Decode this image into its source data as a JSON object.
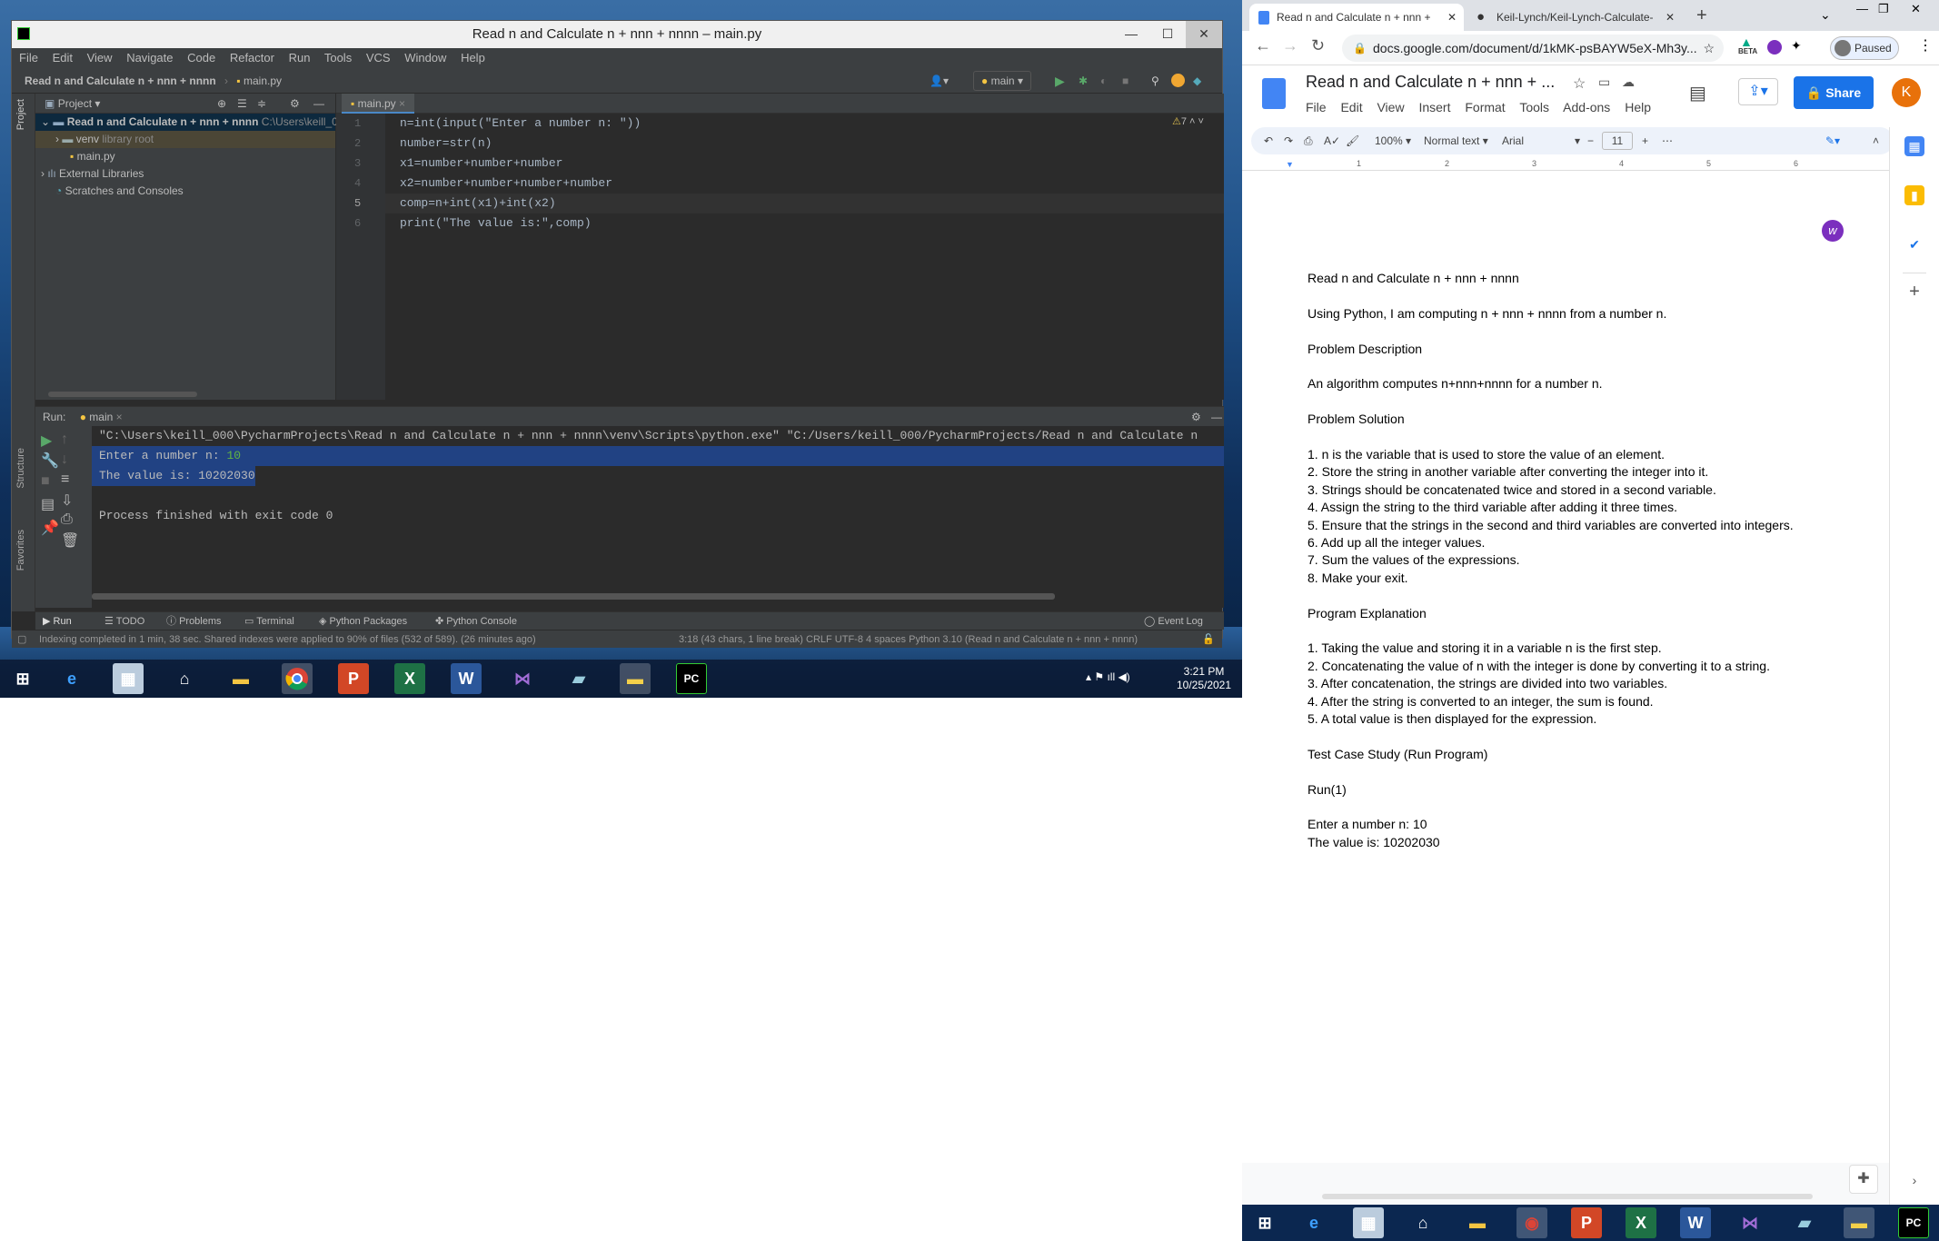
{
  "pycharm": {
    "window_title": "Read n and Calculate n + nnn + nnnn – main.py",
    "menu": [
      "File",
      "Edit",
      "View",
      "Navigate",
      "Code",
      "Refactor",
      "Run",
      "Tools",
      "VCS",
      "Window",
      "Help"
    ],
    "breadcrumb_project": "Read n and Calculate n + nnn + nnnn",
    "breadcrumb_file": "main.py",
    "run_config": "main",
    "project_panel_title": "Project",
    "tree": {
      "root": "Read n and Calculate n + nnn + nnnn",
      "root_path": "C:\\Users\\keill_0",
      "venv": "venv",
      "venv_note": "library root",
      "main": "main.py",
      "external": "External Libraries",
      "scratches": "Scratches and Consoles"
    },
    "editor_tab": "main.py",
    "warning_count": "7",
    "code": [
      "n=int(input(\"Enter a number n: \"))",
      "number=str(n)",
      "x1=number+number+number",
      "x2=number+number+number+number",
      "comp=n+int(x1)+int(x2)",
      "print(\"The value is:\",comp)"
    ],
    "line_numbers": [
      "1",
      "2",
      "3",
      "4",
      "5",
      "6"
    ],
    "run_label": "Run:",
    "run_tab": "main",
    "console": [
      "\"C:\\Users\\keill_000\\PycharmProjects\\Read n and Calculate n + nnn + nnnn\\venv\\Scripts\\python.exe\" \"C:/Users/keill_000/PycharmProjects/Read n and Calculate n",
      "Enter a number n: ",
      "The value is: 10202030",
      "",
      "Process finished with exit code 0"
    ],
    "console_input": "10",
    "bottom_tabs": [
      "Run",
      "TODO",
      "Problems",
      "Terminal",
      "Python Packages",
      "Python Console"
    ],
    "event_log": "Event Log",
    "status_left": "Indexing completed in 1 min, 38 sec. Shared indexes were applied to 90% of files (532 of 589). (26 minutes ago)",
    "status_right": "3:18 (43 chars, 1 line break)   CRLF   UTF-8   4 spaces   Python 3.10 (Read n and Calculate n + nnn + nnnn)",
    "side_labels": [
      "Project",
      "Structure",
      "Favorites"
    ]
  },
  "chrome": {
    "tabs": [
      "Read n and Calculate n + nnn +",
      "Keil-Lynch/Keil-Lynch-Calculate-"
    ],
    "url": "docs.google.com/document/d/1kMK-psBAYW5eX-Mh3y...",
    "paused": "Paused",
    "beta": "BETA",
    "doc_title": "Read n and Calculate n + nnn + ...",
    "doc_menu": [
      "File",
      "Edit",
      "View",
      "Insert",
      "Format",
      "Tools",
      "Add-ons",
      "Help"
    ],
    "share": "Share",
    "avatar": "K",
    "zoom": "100%",
    "style": "Normal text",
    "font": "Arial",
    "font_size": "11",
    "ruler": [
      "1",
      "2",
      "3",
      "4",
      "5",
      "6"
    ],
    "doc_lines": [
      "Read n and Calculate n + nnn + nnnn",
      "",
      "Using Python, I am computing n + nnn + nnnn from a number n.",
      "",
      "Problem Description",
      "",
      "An algorithm computes n+nnn+nnnn for a number n.",
      "",
      "Problem Solution",
      "",
      "1. n is the variable that is used to store the value of an element.",
      "2. Store the string in another variable after converting the integer into it.",
      "3. Strings should be concatenated twice and stored in a second variable.",
      "4. Assign the string to the third variable after adding it three times.",
      "5. Ensure that the strings in the second and third variables are converted into integers.",
      "6. Add up all the integer values.",
      "7. Sum the values of the expressions.",
      "8. Make your exit.",
      "",
      "Program Explanation",
      "",
      "1. Taking the value and storing it in a variable n is the first step.",
      "2. Concatenating the value of n with the integer is done by converting it to a string.",
      "3. After concatenation, the strings are divided into two variables.",
      "4. After the string is converted to an integer, the sum is found.",
      "5. A total value is then displayed for the expression.",
      "",
      "Test Case Study (Run Program)",
      "",
      "Run(1)",
      "",
      "Enter a number n: 10",
      "The value is: 10202030"
    ]
  },
  "taskbar": {
    "time": "3:21 PM",
    "date": "10/25/2021"
  }
}
